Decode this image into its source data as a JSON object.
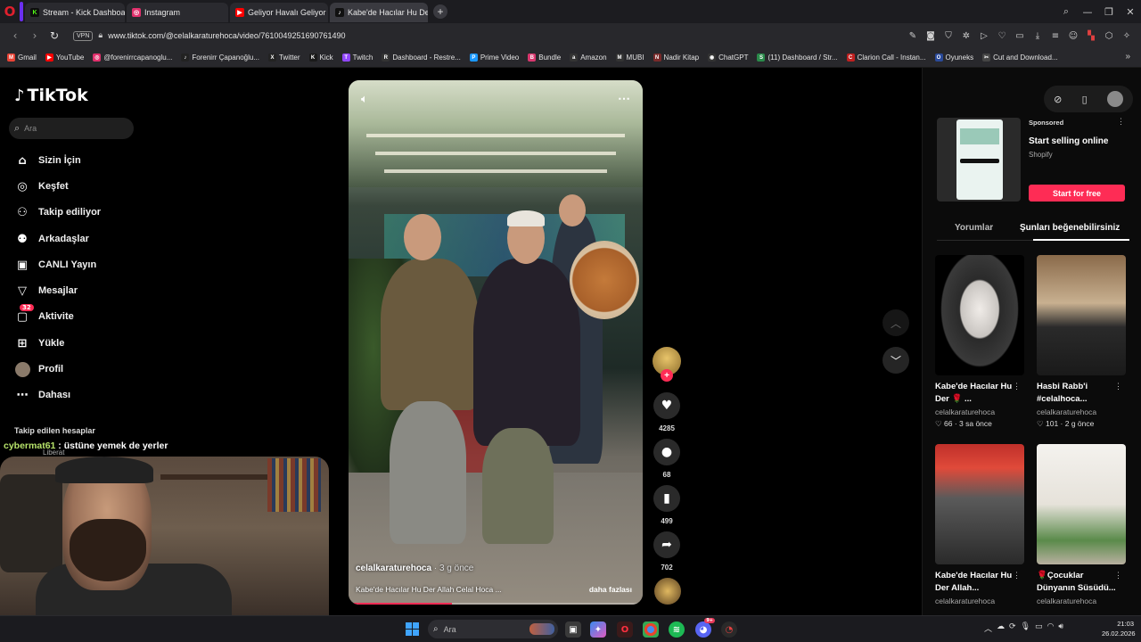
{
  "browser": {
    "tabs": [
      {
        "label": "Stream - Kick Dashboard",
        "fav": "K",
        "color": "#53fc18"
      },
      {
        "label": "Instagram",
        "fav": "◎",
        "color": "#e1306c"
      },
      {
        "label": "Geliyor Havalı Geliyor ■",
        "fav": "▶",
        "color": "#ff0000"
      },
      {
        "label": "Kabe'de Hacılar Hu Der: C",
        "fav": "♪",
        "color": "#111111"
      }
    ],
    "new_tab": "+",
    "url": "www.tiktok.com/@celalkaraturehoca/video/7610049251690761490",
    "vpn": "VPN",
    "bookmarks": [
      {
        "label": "Gmail",
        "fav": "M",
        "color": "#ea4335"
      },
      {
        "label": "YouTube",
        "fav": "▶",
        "color": "#ff0000"
      },
      {
        "label": "@forenirrcapanoglu...",
        "fav": "◎",
        "color": "#e1306c"
      },
      {
        "label": "Forenirr Çapanoğlu...",
        "fav": "♪",
        "color": "#222222"
      },
      {
        "label": "Twitter",
        "fav": "X",
        "color": "#222222"
      },
      {
        "label": "Kick",
        "fav": "K",
        "color": "#1a1a1a"
      },
      {
        "label": "Twitch",
        "fav": "T",
        "color": "#9146ff"
      },
      {
        "label": "Dashboard - Restre...",
        "fav": "R",
        "color": "#333333"
      },
      {
        "label": "Prime Video",
        "fav": "P",
        "color": "#1a98ff"
      },
      {
        "label": "Bundle",
        "fav": "B",
        "color": "#d9376e"
      },
      {
        "label": "Amazon",
        "fav": "a",
        "color": "#333333"
      },
      {
        "label": "MUBI",
        "fav": "M",
        "color": "#333333"
      },
      {
        "label": "Nadir Kitap",
        "fav": "N",
        "color": "#7a2a2a"
      },
      {
        "label": "ChatGPT",
        "fav": "◉",
        "color": "#333333"
      },
      {
        "label": "(11) Dashboard / Str...",
        "fav": "S",
        "color": "#2a8a4a"
      },
      {
        "label": "Clarion Call - Instan...",
        "fav": "C",
        "color": "#c02020"
      },
      {
        "label": "Oyuneks",
        "fav": "O",
        "color": "#2a4a9a"
      },
      {
        "label": "Cut and Download...",
        "fav": "✂",
        "color": "#444444"
      }
    ]
  },
  "tiktok": {
    "logo": "TikTok",
    "search_placeholder": "Ara",
    "nav": [
      {
        "label": "Sizin İçin",
        "icon": "home-icon",
        "glyph": "⌂"
      },
      {
        "label": "Keşfet",
        "icon": "compass-icon",
        "glyph": "◎"
      },
      {
        "label": "Takip ediliyor",
        "icon": "following-icon",
        "glyph": "⚇"
      },
      {
        "label": "Arkadaşlar",
        "icon": "friends-icon",
        "glyph": "⚉"
      },
      {
        "label": "CANLI Yayın",
        "icon": "live-icon",
        "glyph": "▣"
      },
      {
        "label": "Mesajlar",
        "icon": "messages-icon",
        "glyph": "▽"
      },
      {
        "label": "Aktivite",
        "icon": "activity-icon",
        "glyph": "▢",
        "badge": "32"
      },
      {
        "label": "Yükle",
        "icon": "upload-icon",
        "glyph": "⊞"
      },
      {
        "label": "Profil",
        "icon": "profile-icon",
        "glyph": ""
      },
      {
        "label": "Dahası",
        "icon": "more-icon",
        "glyph": "⋯"
      }
    ],
    "following_header": "Takip edilen hesaplar",
    "followed_account": "Liberat",
    "chat": {
      "user": "cybermat61",
      "message": " : üstüne yemek de yerler"
    }
  },
  "video": {
    "author": "celalkaraturehoca",
    "ago": " · 3 g önce",
    "caption": "Kabe'de Hacılar Hu Der Allah Celal Hoca ...",
    "more": "daha fazlası",
    "progress": 0.35,
    "likes": "4285",
    "comments": "68",
    "saves": "499",
    "shares": "702"
  },
  "right_panel": {
    "ad": {
      "sponsored": "Sponsored",
      "title": "Start selling online",
      "brand": "Shopify",
      "cta": "Start for free"
    },
    "tabs": [
      "Yorumlar",
      "Şunları beğenebilirsiniz"
    ],
    "cards": [
      {
        "title": "Kabe'de Hacılar Hu Der 🌹 ...",
        "author": "celalkaraturehoca",
        "likes": "66",
        "ago": "3 sa önce"
      },
      {
        "title": "Hasbi Rabb'i #celalhoca...",
        "author": "celalkaraturehoca",
        "likes": "101",
        "ago": "2 g önce"
      },
      {
        "title": "Kabe'de Hacılar Hu Der Allah...",
        "author": "celalkaraturehoca",
        "likes": "",
        "ago": ""
      },
      {
        "title": "🌹Çocuklar Dünyanın Süsüdü...",
        "author": "celalkaraturehoca",
        "likes": "",
        "ago": ""
      }
    ]
  },
  "taskbar": {
    "search_placeholder": "Ara",
    "time": "21:03",
    "date": "26.02.2026",
    "discord_badge": "9+"
  }
}
